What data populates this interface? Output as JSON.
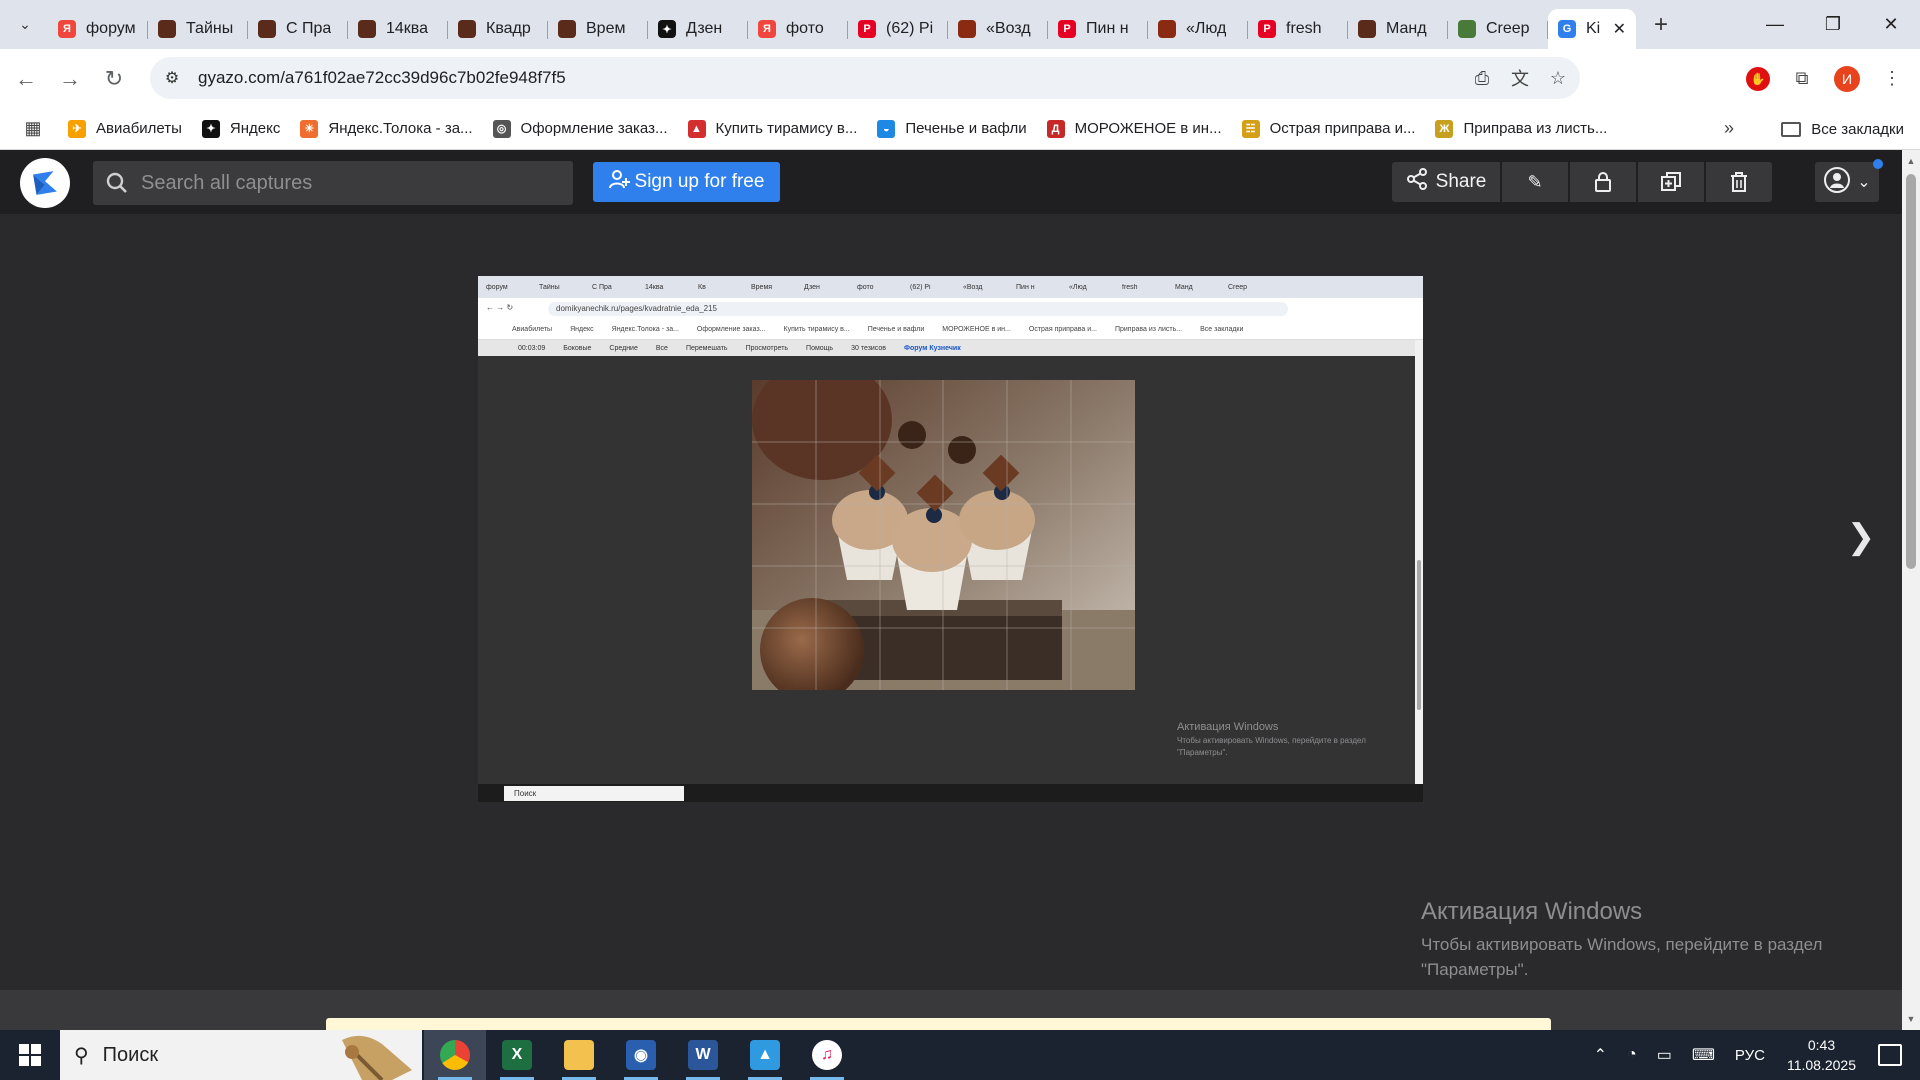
{
  "browser": {
    "tabs": [
      {
        "label": "форум",
        "favicon_color": "#f0463d",
        "favicon_glyph": "Я"
      },
      {
        "label": "Тайны",
        "favicon_color": "#5a2a1a",
        "favicon_glyph": ""
      },
      {
        "label": "С Пра",
        "favicon_color": "#5a2a1a",
        "favicon_glyph": ""
      },
      {
        "label": "14ква",
        "favicon_color": "#5a2a1a",
        "favicon_glyph": ""
      },
      {
        "label": "Квадр",
        "favicon_color": "#5a2a1a",
        "favicon_glyph": ""
      },
      {
        "label": "Врем",
        "favicon_color": "#5a2a1a",
        "favicon_glyph": ""
      },
      {
        "label": "Дзен",
        "favicon_color": "#111111",
        "favicon_glyph": "✦"
      },
      {
        "label": "фото",
        "favicon_color": "#f0463d",
        "favicon_glyph": "Я"
      },
      {
        "label": "(62) Pi",
        "favicon_color": "#e60023",
        "favicon_glyph": "P"
      },
      {
        "label": "«Возд",
        "favicon_color": "#8b2a12",
        "favicon_glyph": ""
      },
      {
        "label": "Пин н",
        "favicon_color": "#e60023",
        "favicon_glyph": "P"
      },
      {
        "label": "«Люд",
        "favicon_color": "#8b2a12",
        "favicon_glyph": ""
      },
      {
        "label": "fresh",
        "favicon_color": "#e60023",
        "favicon_glyph": "P"
      },
      {
        "label": "Манд",
        "favicon_color": "#5a2a1a",
        "favicon_glyph": ""
      },
      {
        "label": "Creep",
        "favicon_color": "#4a7a3a",
        "favicon_glyph": ""
      }
    ],
    "active_tab": {
      "label": "Ki",
      "close_glyph": "✕"
    },
    "url": "gyazo.com/a761f02ae72cc39d96c7b02fe948f7f5",
    "bookmarks": [
      {
        "label": "Авиабилеты",
        "color": "#f6a100",
        "glyph": "✈"
      },
      {
        "label": "Яндекс",
        "color": "#111111",
        "glyph": "✦"
      },
      {
        "label": "Яндекс.Толока - за...",
        "color": "#f06d2f",
        "glyph": "✳"
      },
      {
        "label": "Оформление заказ...",
        "color": "#555555",
        "glyph": "◎"
      },
      {
        "label": "Купить тирамису в...",
        "color": "#d32f2f",
        "glyph": "▲"
      },
      {
        "label": "Печенье и вафли",
        "color": "#1e88e5",
        "glyph": "◒"
      },
      {
        "label": "МОРОЖЕНОЕ в ин...",
        "color": "#c62828",
        "glyph": "Д"
      },
      {
        "label": "Острая приправа и...",
        "color": "#d4a017",
        "glyph": "☵"
      },
      {
        "label": "Приправа из листь...",
        "color": "#c8a020",
        "glyph": "Ж"
      }
    ],
    "all_bookmarks": "Все закладки",
    "profile_initial": "И"
  },
  "gyazo": {
    "search_placeholder": "Search all captures",
    "signup_label": "Sign up for free",
    "share_label": "Share",
    "brand_color": "#2f80ed"
  },
  "capture": {
    "url": "domikyanechik.ru/pages/kvadratnie_eda_215",
    "menu": [
      "00:03:09",
      "Боковые",
      "Средние",
      "Все",
      "Перемешать",
      "Просмотреть",
      "Помощь",
      "30 тезисов"
    ],
    "forum_link": "Форум Кузнечик",
    "activation_title": "Активация Windows",
    "activation_text": "Чтобы активировать Windows, перейдите в раздел \"Параметры\".",
    "taskbar_search": "Поиск",
    "tabs": [
      "форум",
      "Тайны",
      "С Пра",
      "14ква",
      "Кв",
      "Время",
      "Дзен",
      "фото",
      "(62) Pi",
      "«Возд",
      "Пин н",
      "«Люд",
      "fresh",
      "Манд",
      "Creep"
    ],
    "bookmarks": [
      "Авиабилеты",
      "Яндекс",
      "Яндекс.Толока - за...",
      "Оформление заказ...",
      "Купить тирамису в...",
      "Печенье и вафли",
      "МОРОЖЕНОЕ в ин...",
      "Острая приправа и...",
      "Приправа из листь...",
      "Все закладки"
    ]
  },
  "overlay": {
    "activation_title": "Активация Windows",
    "activation_line1": "Чтобы активировать Windows, перейдите в раздел",
    "activation_line2": "\"Параметры\"."
  },
  "taskbar": {
    "search_placeholder": "Поиск",
    "language": "РУС",
    "time": "0:43",
    "date": "11.08.2025",
    "apps": [
      {
        "name": "chrome",
        "active": true
      },
      {
        "name": "excel",
        "active": false
      },
      {
        "name": "file-explorer",
        "active": false
      },
      {
        "name": "media-app",
        "active": false
      },
      {
        "name": "word",
        "active": false
      },
      {
        "name": "photos",
        "active": false
      },
      {
        "name": "itunes",
        "active": false
      }
    ]
  }
}
